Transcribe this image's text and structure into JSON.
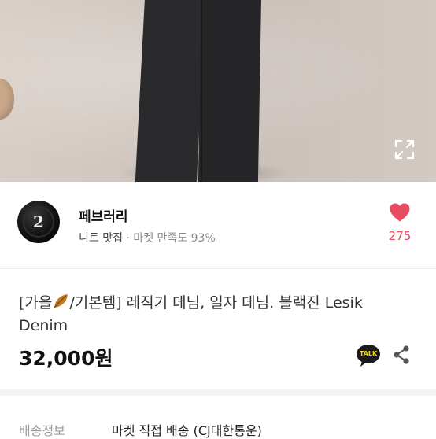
{
  "hero": {
    "expand_icon": "expand-icon"
  },
  "seller": {
    "avatar_glyph": "2",
    "name": "페브러리",
    "tagline": "니트 맛집",
    "separator": " · ",
    "satisfaction": "마켓 만족도 93%",
    "like_count": "275",
    "like_color": "#e84a5f"
  },
  "product": {
    "title_prefix": "[가을",
    "title_rest": "/기본템] 레직기 데님, 일자 데님. 블랙진 Lesik Denim",
    "price": "32,000원"
  },
  "actions": {
    "talk_label": "TALK"
  },
  "shipping": {
    "label": "배송정보",
    "value": "마켓 직접 배송 (CJ대한통운)"
  }
}
